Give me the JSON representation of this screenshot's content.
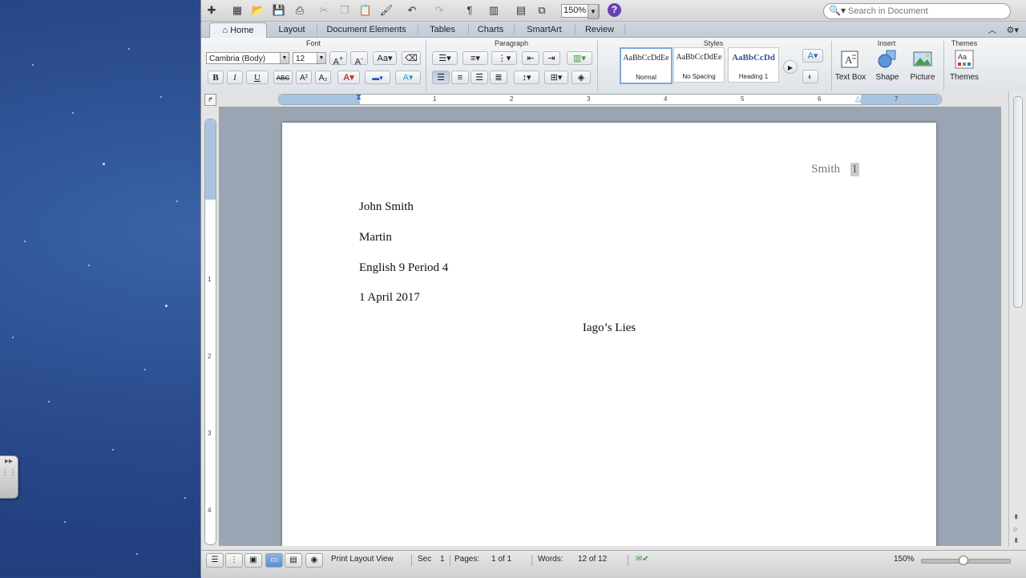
{
  "toolbar": {
    "zoom": "150%",
    "search_placeholder": "Search in Document"
  },
  "tabs": [
    "Home",
    "Layout",
    "Document Elements",
    "Tables",
    "Charts",
    "SmartArt",
    "Review"
  ],
  "ribbon": {
    "groups": {
      "font": "Font",
      "paragraph": "Paragraph",
      "styles": "Styles",
      "insert": "Insert",
      "themes": "Themes"
    },
    "font_name": "Cambria (Body)",
    "font_size": "12",
    "bold": "B",
    "italic": "I",
    "underline": "U",
    "strike": "ABC",
    "superscript": "A²",
    "subscript": "A₂",
    "styles": [
      {
        "sample": "AaBbCcDdEe",
        "label": "Normal"
      },
      {
        "sample": "AaBbCcDdEe",
        "label": "No Spacing"
      },
      {
        "sample": "AaBbCcDd",
        "label": "Heading 1"
      }
    ],
    "insert_buttons": [
      "Text Box",
      "Shape",
      "Picture"
    ],
    "themes_button": "Themes"
  },
  "ruler": {
    "h_numbers": [
      "1",
      "2",
      "3",
      "4",
      "5",
      "6",
      "7"
    ],
    "v_numbers": [
      "1",
      "2",
      "3",
      "4"
    ]
  },
  "document": {
    "header_name": "Smith",
    "header_page": "1",
    "lines": [
      "John Smith",
      "Martin",
      "English 9 Period 4",
      "1 April 2017"
    ],
    "title": "Iago’s Lies"
  },
  "status": {
    "view": "Print Layout View",
    "sec_label": "Sec",
    "sec_value": "1",
    "pages_label": "Pages:",
    "pages_value": "1 of 1",
    "words_label": "Words:",
    "words_value": "12 of 12",
    "zoom": "150%"
  }
}
